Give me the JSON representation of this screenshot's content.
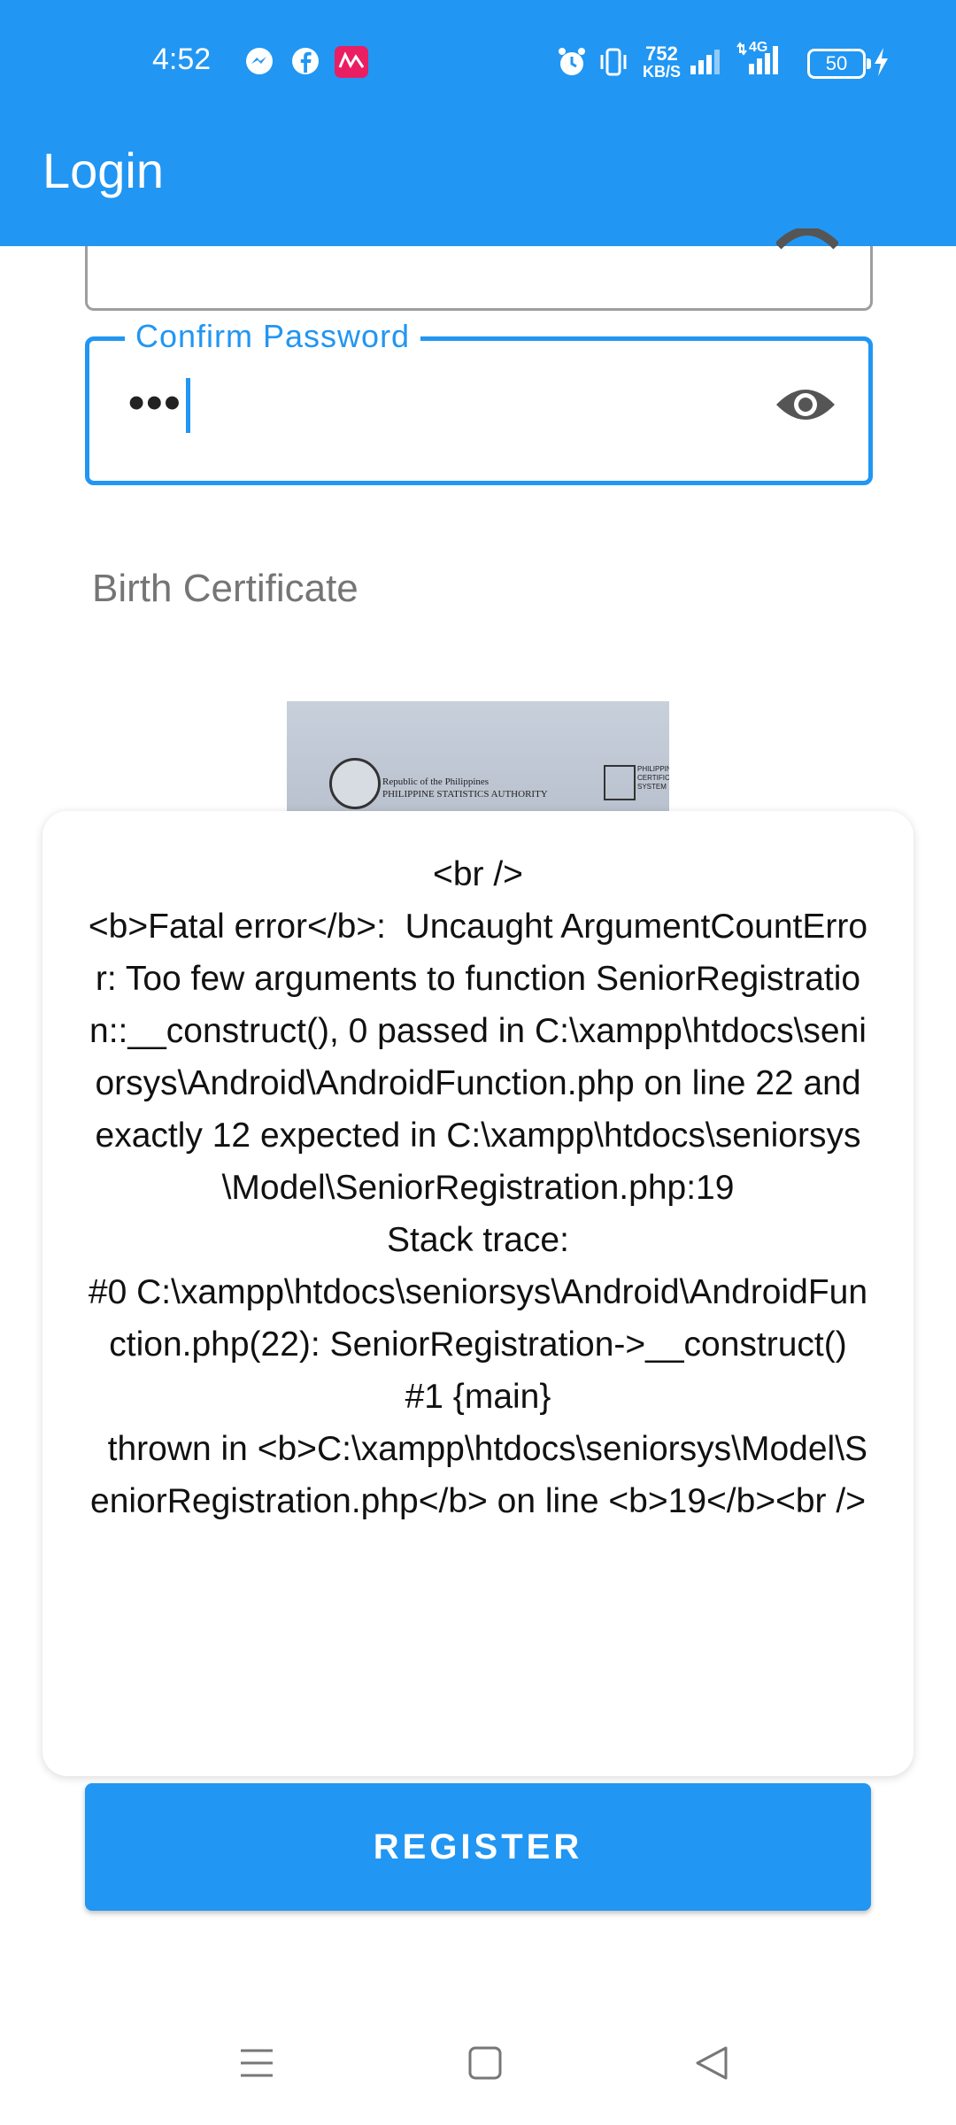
{
  "status_bar": {
    "time": "4:52",
    "net_speed_value": "752",
    "net_speed_unit": "KB/S",
    "network": "4G",
    "battery": "50"
  },
  "app_bar": {
    "title": "Login"
  },
  "form": {
    "confirm_password_label": "Confirm Password",
    "confirm_password_value": "•••",
    "birth_certificate_label": "Birth Certificate"
  },
  "certificate_image": {
    "line1": "Republic of the Philippines",
    "line2": "PHILIPPINE STATISTICS AUTHORITY",
    "right_lines": [
      "PHILIPPIN",
      "CERTIFIC",
      "SYSTEM"
    ]
  },
  "dialog": {
    "message": "<br />\n<b>Fatal error</b>:  Uncaught ArgumentCountError: Too few arguments to function SeniorRegistration::__construct(), 0 passed in C:\\xampp\\htdocs\\seniorsys\\Android\\AndroidFunction.php on line 22 and exactly 12 expected in C:\\xampp\\htdocs\\seniorsys\\Model\\SeniorRegistration.php:19\nStack trace:\n#0 C:\\xampp\\htdocs\\seniorsys\\Android\\AndroidFunction.php(22): SeniorRegistration->__construct()\n#1 {main}\n  thrown in <b>C:\\xampp\\htdocs\\seniorsys\\Model\\SeniorRegistration.php</b> on line <b>19</b><br />"
  },
  "register_button": {
    "label": "REGISTER"
  },
  "colors": {
    "primary": "#2196f3",
    "label_gray": "#757575"
  }
}
